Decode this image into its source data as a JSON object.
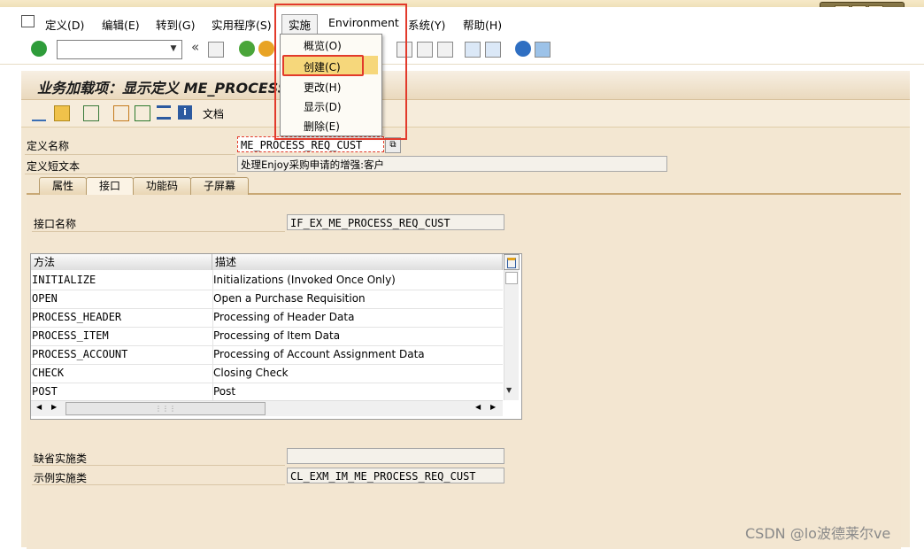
{
  "menubar": {
    "items": [
      "定义(D)",
      "编辑(E)",
      "转到(G)",
      "实用程序(S)",
      "实施",
      "Environment",
      "系统(Y)",
      "帮助(H)"
    ]
  },
  "implement_menu": {
    "items": [
      "概览(O)",
      "创建(C)",
      "更改(H)",
      "显示(D)",
      "删除(E)"
    ],
    "highlighted": "创建(C)"
  },
  "screen": {
    "title": "业务加载项：显示定义 ME_PROCESS_REQ_CUST",
    "doc_button": "文档"
  },
  "definition": {
    "name_label": "定义名称",
    "name_value": "ME_PROCESS_REQ_CUST",
    "short_text_label": "定义短文本",
    "short_text_value": "处理Enjoy采购申请的增强:客户"
  },
  "tabs": [
    "属性",
    "接口",
    "功能码",
    "子屏幕"
  ],
  "active_tab": "接口",
  "interface": {
    "name_label": "接口名称",
    "name_value": "IF_EX_ME_PROCESS_REQ_CUST",
    "default_impl_label": "缺省实施类",
    "default_impl_value": "",
    "example_impl_label": "示例实施类",
    "example_impl_value": "CL_EXM_IM_ME_PROCESS_REQ_CUST"
  },
  "methods_table": {
    "columns": [
      "方法",
      "描述"
    ],
    "rows": [
      {
        "method": "INITIALIZE",
        "desc": "Initializations (Invoked Once Only)"
      },
      {
        "method": "OPEN",
        "desc": "Open a Purchase Requisition"
      },
      {
        "method": "PROCESS_HEADER",
        "desc": "Processing of Header Data"
      },
      {
        "method": "PROCESS_ITEM",
        "desc": "Processing of Item Data"
      },
      {
        "method": "PROCESS_ACCOUNT",
        "desc": "Processing of Account Assignment Data"
      },
      {
        "method": "CHECK",
        "desc": "Closing Check"
      },
      {
        "method": "POST",
        "desc": "Post"
      }
    ]
  },
  "watermark": "CSDN @lo波德莱尔ve",
  "colors": {
    "accent": "#e23a2b",
    "menu_highlight": "#f6d77b",
    "panel": "#f3e6d1"
  }
}
